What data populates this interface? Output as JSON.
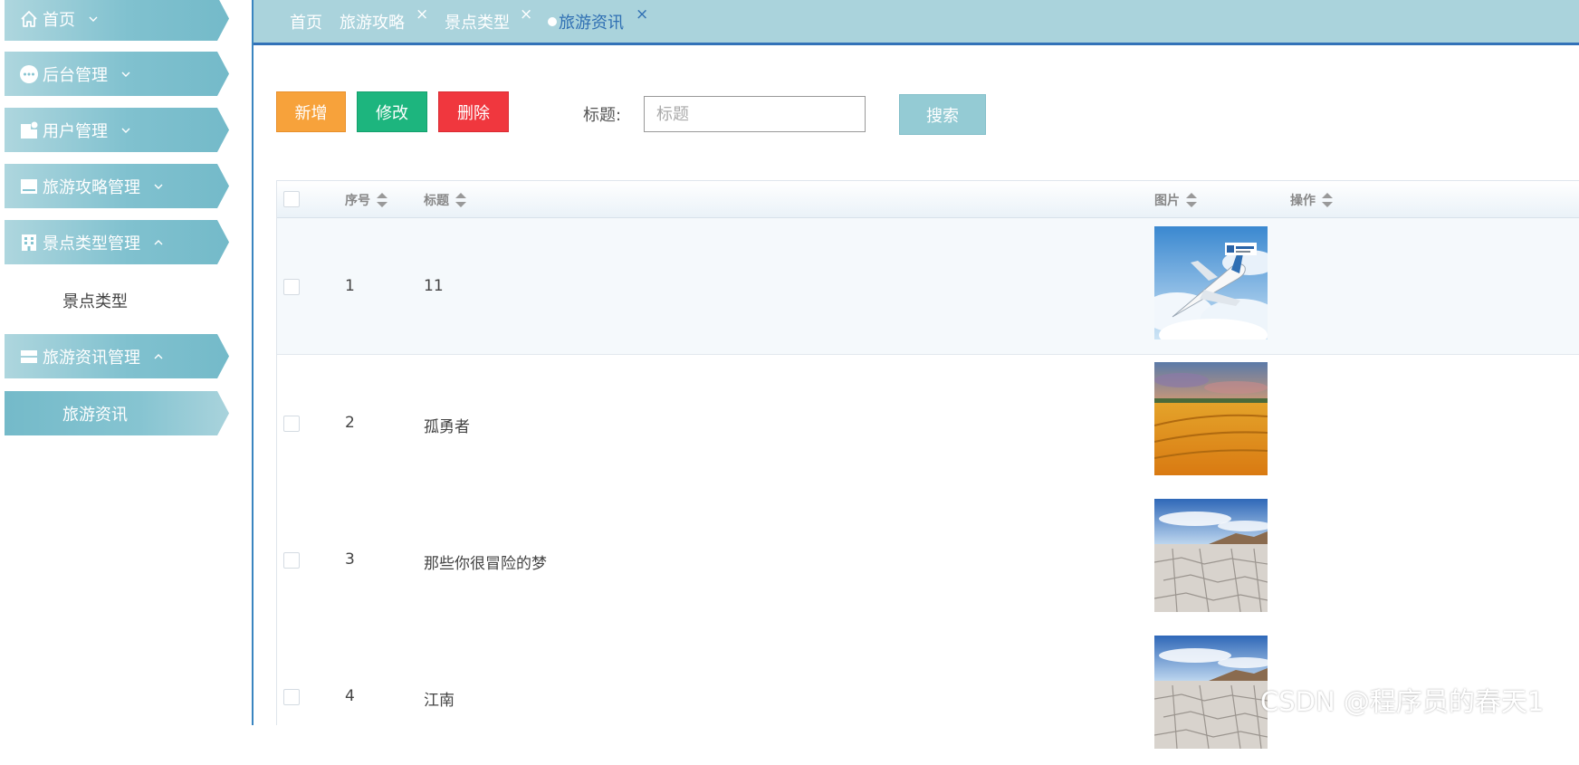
{
  "sidebar": {
    "items": [
      {
        "label": "首页",
        "icon": "home-icon",
        "arrow": "chevron-down-icon"
      },
      {
        "label": "后台管理",
        "icon": "more-icon",
        "arrow": "chevron-down-icon"
      },
      {
        "label": "用户管理",
        "icon": "user-doc-icon",
        "arrow": "chevron-down-icon"
      },
      {
        "label": "旅游攻略管理",
        "icon": "inbox-icon",
        "arrow": "chevron-down-icon"
      },
      {
        "label": "景点类型管理",
        "icon": "building-icon",
        "arrow": "chevron-up-icon"
      },
      {
        "label": "旅游资讯管理",
        "icon": "server-icon",
        "arrow": "chevron-up-icon"
      }
    ],
    "subitems": {
      "scenic_type": "景点类型",
      "travel_news": "旅游资讯"
    }
  },
  "tabs": [
    {
      "label": "首页",
      "closable": false
    },
    {
      "label": "旅游攻略",
      "closable": true
    },
    {
      "label": "景点类型",
      "closable": true
    },
    {
      "label": "旅游资讯",
      "closable": true,
      "active": true
    }
  ],
  "tab_close_glyph": "×",
  "toolbar": {
    "add_label": "新增",
    "edit_label": "修改",
    "delete_label": "删除",
    "search_label": "标题:",
    "search_placeholder": "标题",
    "search_value": "",
    "search_button": "搜索"
  },
  "table": {
    "columns": [
      "序号",
      "标题",
      "图片",
      "操作"
    ],
    "rows": [
      {
        "index": "1",
        "title": "11",
        "image": "airplane-in-clouds"
      },
      {
        "index": "2",
        "title": "孤勇者",
        "image": "golden-wheat-field"
      },
      {
        "index": "3",
        "title": "那些你很冒险的梦",
        "image": "cracked-desert-sky"
      },
      {
        "index": "4",
        "title": "江南",
        "image": "cracked-desert-sky"
      }
    ]
  },
  "watermark": "CSDN @程序员的春天1",
  "colors": {
    "sidebar_accent": "#80c1cf",
    "tabbar_bg": "#aad3dc",
    "tabbar_border": "#3272b8",
    "add": "#f7a23b",
    "edit": "#1db57e",
    "delete": "#f0373e",
    "search": "#94cbd4"
  }
}
